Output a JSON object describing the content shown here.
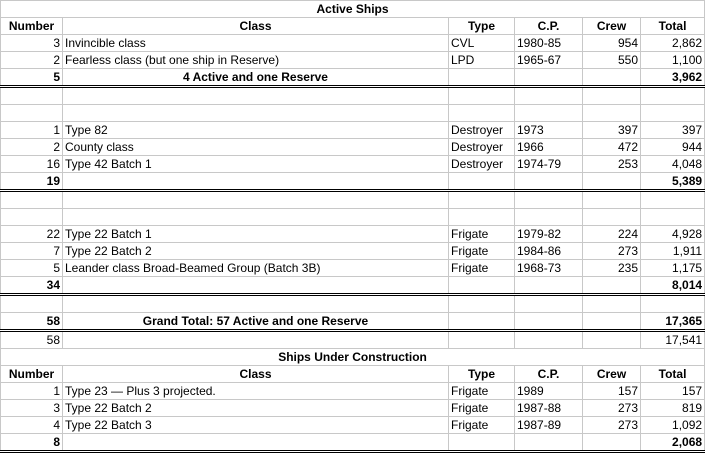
{
  "sections": {
    "active_title": "Active Ships",
    "construction_title": "Ships Under Construction"
  },
  "headers": {
    "number": "Number",
    "class": "Class",
    "type": "Type",
    "cp": "C.P.",
    "crew": "Crew",
    "total": "Total"
  },
  "group1": {
    "rows": [
      {
        "number": "3",
        "class": "Invincible class",
        "type": "CVL",
        "cp": "1980-85",
        "crew": "954",
        "total": "2,862"
      },
      {
        "number": "2",
        "class": "Fearless class (but one ship in Reserve)",
        "type": "LPD",
        "cp": "1965-67",
        "crew": "550",
        "total": "1,100"
      }
    ],
    "subtotal_number": "5",
    "subtotal_label": "4 Active and one Reserve",
    "subtotal_total": "3,962"
  },
  "group2": {
    "rows": [
      {
        "number": "1",
        "class": "Type 82",
        "type": "Destroyer",
        "cp": "1973",
        "crew": "397",
        "total": "397"
      },
      {
        "number": "2",
        "class": "County class",
        "type": "Destroyer",
        "cp": "1966",
        "crew": "472",
        "total": "944"
      },
      {
        "number": "16",
        "class": "Type 42 Batch 1",
        "type": "Destroyer",
        "cp": "1974-79",
        "crew": "253",
        "total": "4,048"
      }
    ],
    "subtotal_number": "19",
    "subtotal_total": "5,389"
  },
  "group3": {
    "rows": [
      {
        "number": "22",
        "class": "Type 22 Batch 1",
        "type": "Frigate",
        "cp": "1979-82",
        "crew": "224",
        "total": "4,928"
      },
      {
        "number": "7",
        "class": "Type 22 Batch 2",
        "type": "Frigate",
        "cp": "1984-86",
        "crew": "273",
        "total": "1,911"
      },
      {
        "number": "5",
        "class": "Leander class Broad-Beamed Group (Batch 3B)",
        "type": "Frigate",
        "cp": "1968-73",
        "crew": "235",
        "total": "1,175"
      }
    ],
    "subtotal_number": "34",
    "subtotal_total": "8,014"
  },
  "grand": {
    "number": "58",
    "label": "Grand Total: 57 Active and one Reserve",
    "total": "17,365",
    "check_number": "58",
    "check_total": "17,541"
  },
  "construction": {
    "rows": [
      {
        "number": "1",
        "class": "Type 23 — Plus 3 projected.",
        "type": "Frigate",
        "cp": "1989",
        "crew": "157",
        "total": "157"
      },
      {
        "number": "3",
        "class": "Type 22 Batch 2",
        "type": "Frigate",
        "cp": "1987-88",
        "crew": "273",
        "total": "819"
      },
      {
        "number": "4",
        "class": "Type 22 Batch 3",
        "type": "Frigate",
        "cp": "1987-89",
        "crew": "273",
        "total": "1,092"
      }
    ],
    "subtotal_number": "8",
    "subtotal_total": "2,068"
  }
}
